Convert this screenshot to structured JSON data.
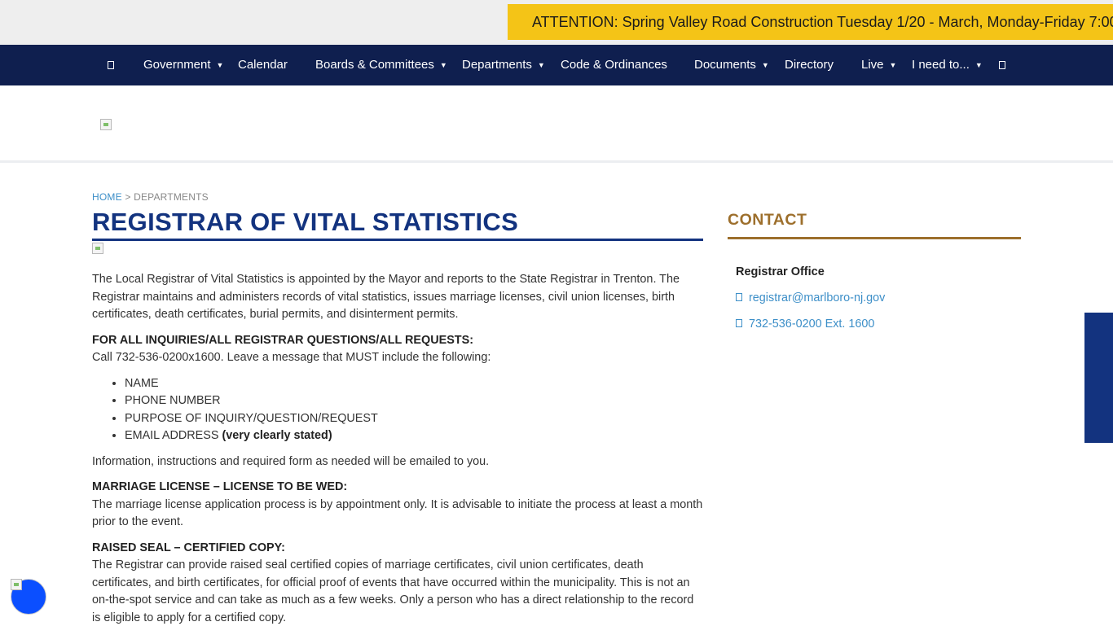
{
  "alert": {
    "text": "ATTENTION: Spring Valley Road Construction Tuesday 1/20 - March, Monday-Friday 7:00"
  },
  "nav": {
    "items": [
      {
        "label": "Government",
        "caret": "▼"
      },
      {
        "label": "Calendar"
      },
      {
        "label": "Boards & Committees",
        "caret": "▼"
      },
      {
        "label": "Departments",
        "caret": "▼"
      },
      {
        "label": "Code & Ordinances"
      },
      {
        "label": "Documents",
        "caret": "▼"
      },
      {
        "label": "Directory"
      },
      {
        "label": "Live",
        "caret": "▼"
      },
      {
        "label": "I need to...",
        "caret": "▼"
      }
    ],
    "icons": [
      "home-icon",
      "search-icon"
    ]
  },
  "breadcrumb": {
    "home": "HOME",
    "separator": " > ",
    "current": "DEPARTMENTS"
  },
  "page": {
    "title": "REGISTRAR OF VITAL STATISTICS",
    "intro": "The Local Registrar of Vital Statistics is appointed by the Mayor and reports to the State Registrar in Trenton. The Registrar maintains and administers records of vital statistics, issues marriage licenses, civil union licenses, birth certificates, death certificates, burial permits, and disinterment permits.",
    "inquiries_heading": "FOR ALL INQUIRIES/ALL REGISTRAR QUESTIONS/ALL REQUESTS:",
    "inquiries_text": "Call 732-536-0200x1600. Leave a message that MUST include the following:",
    "requirements": [
      "NAME",
      "PHONE NUMBER",
      "PURPOSE OF INQUIRY/QUESTION/REQUEST"
    ],
    "requirement_email": "EMAIL ADDRESS",
    "requirement_email_note": "(very clearly stated)",
    "info_text": "Information, instructions and required form as needed will be emailed to you.",
    "marriage_heading": "MARRIAGE LICENSE – LICENSE TO BE WED:",
    "marriage_text": "The marriage license application process is by appointment only. It is advisable to initiate the process at least a month prior to the event.",
    "seal_heading": "RAISED SEAL – CERTIFIED COPY:",
    "seal_text": "The Registrar can provide raised seal certified copies of marriage certificates, civil union certificates, death certificates, and birth certificates, for official proof of events that have occurred within the municipality. This is not an on-the-spot service and can take as much as a few weeks. Only a person who has a direct relationship to the record is eligible to apply for a certified copy."
  },
  "contact": {
    "title": "CONTACT",
    "office": "Registrar Office",
    "email": "registrar@marlboro-nj.gov",
    "phone": "732-536-0200 Ext. 1600"
  },
  "colors": {
    "nav_bg": "#0f1f4f",
    "alert_bg": "#f4c417",
    "title": "#13337f",
    "contact_accent": "#9d6f2c",
    "link": "#3d8fc8",
    "a11y_button": "#0b4fff"
  }
}
